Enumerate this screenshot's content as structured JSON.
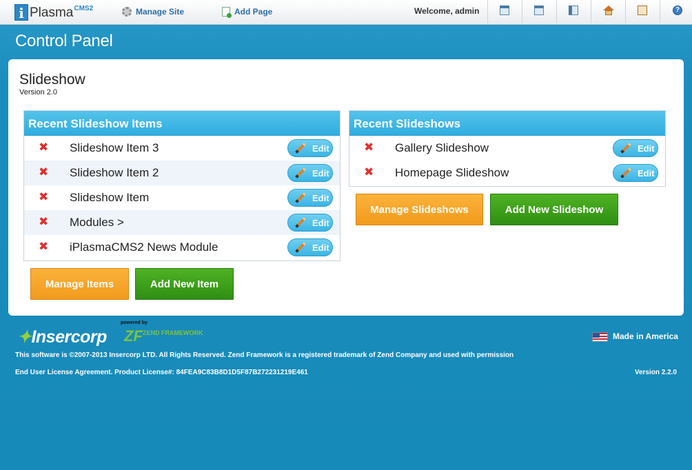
{
  "topbar": {
    "logo_main": "Plasma",
    "logo_letter": "i",
    "logo_sup": "CMS2",
    "manage_site": "Manage Site",
    "add_page": "Add Page",
    "welcome": "Welcome, admin",
    "help_glyph": "?"
  },
  "page": {
    "title": "Control Panel",
    "module_title": "Slideshow",
    "module_version": "Version 2.0"
  },
  "recent_items": {
    "header": "Recent Slideshow Items",
    "rows": [
      {
        "label": "Slideshow Item 3",
        "edit": "Edit"
      },
      {
        "label": "Slideshow Item 2",
        "edit": "Edit"
      },
      {
        "label": "Slideshow Item",
        "edit": "Edit"
      },
      {
        "label": "Modules >",
        "edit": "Edit"
      },
      {
        "label": "iPlasmaCMS2 News Module",
        "edit": "Edit"
      }
    ],
    "manage_button": "Manage Items",
    "add_button": "Add New Item"
  },
  "recent_slideshows": {
    "header": "Recent Slideshows",
    "rows": [
      {
        "label": "Gallery Slideshow",
        "edit": "Edit"
      },
      {
        "label": "Homepage Slideshow",
        "edit": "Edit"
      }
    ],
    "manage_button": "Manage Slideshows",
    "add_button": "Add New Slideshow"
  },
  "footer": {
    "brand": "Insercorp",
    "powered_by": "powered by",
    "zf_logo": "ZF",
    "zf_text": "ZEND FRAMEWORK",
    "made_in": "Made in America",
    "copyright": "This software is ©2007-2013 Insercorp LTD. All Rights Reserved. Zend Framework is a registered trademark of Zend Company and used with permission",
    "license": "End User License Agreement. Product License#: 84FEA9C83B8D1D5F87B272231219E461",
    "version": "Version 2.2.0"
  },
  "colors": {
    "background": "#1b8dbd",
    "header_blue": "#30addf",
    "orange": "#f19b1d",
    "green": "#2f8f14",
    "delete_red": "#e03030"
  }
}
